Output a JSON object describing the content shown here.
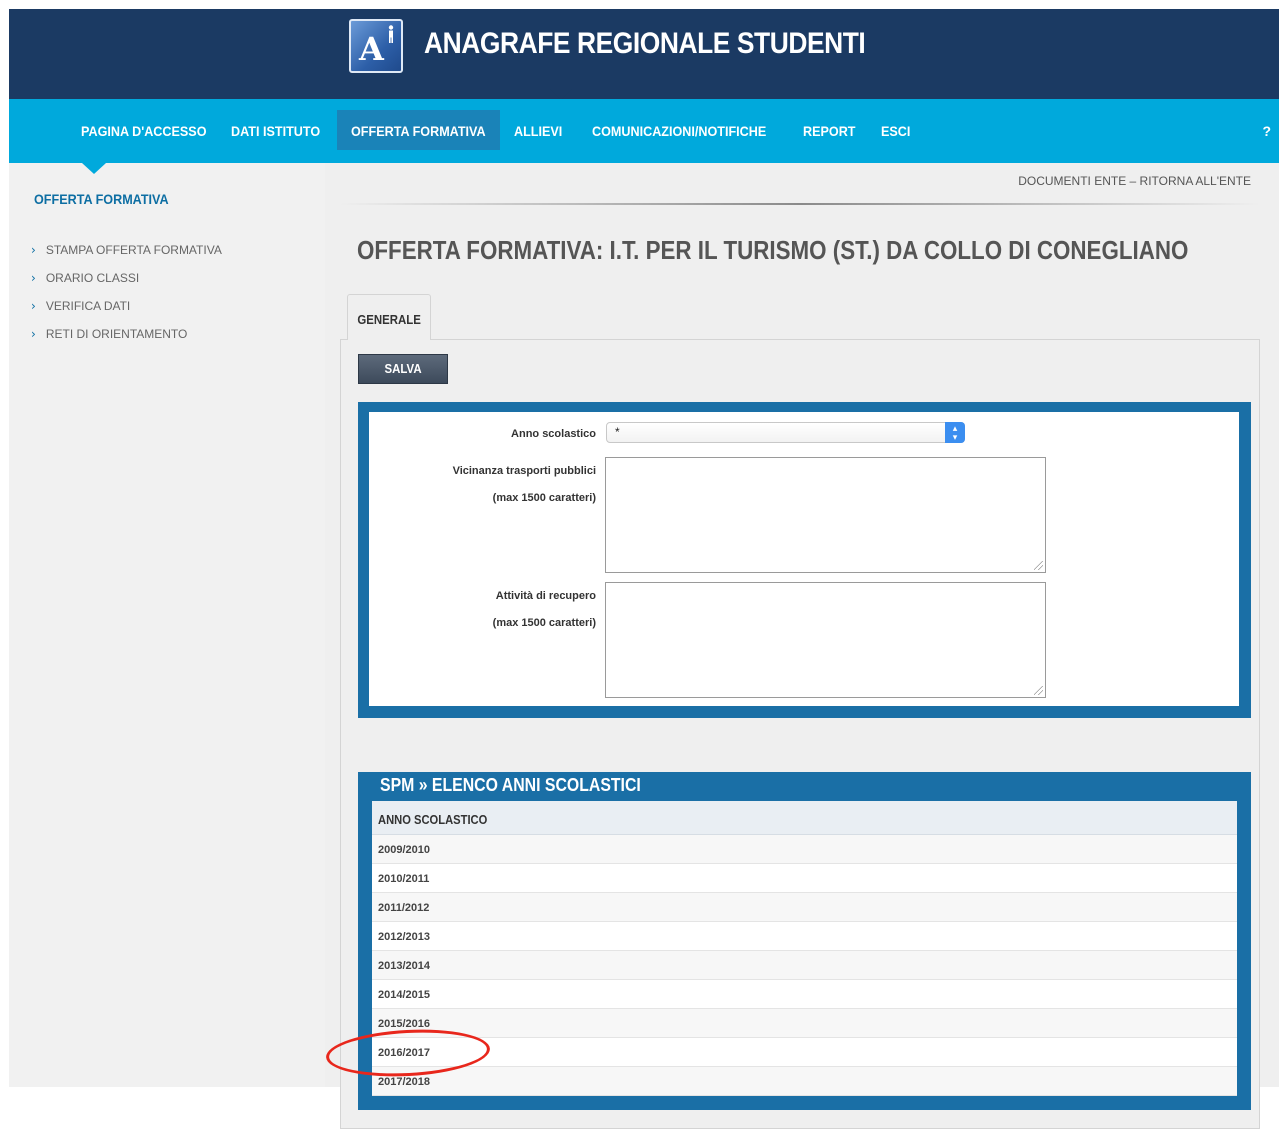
{
  "app": {
    "title": "ANAGRAFE REGIONALE STUDENTI",
    "logo_letter": "A"
  },
  "nav": {
    "items": [
      {
        "label": "PAGINA D'ACCESSO"
      },
      {
        "label": "DATI ISTITUTO"
      },
      {
        "label": "OFFERTA FORMATIVA",
        "active": true
      },
      {
        "label": "ALLIEVI"
      },
      {
        "label": "COMUNICAZIONI/NOTIFICHE"
      },
      {
        "label": "REPORT"
      },
      {
        "label": "ESCI"
      }
    ],
    "help": "?"
  },
  "sidebar": {
    "title": "OFFERTA FORMATIVA",
    "items": [
      {
        "label": "STAMPA OFFERTA FORMATIVA"
      },
      {
        "label": "ORARIO CLASSI"
      },
      {
        "label": "VERIFICA DATI"
      },
      {
        "label": "RETI DI ORIENTAMENTO"
      }
    ]
  },
  "top_links": "DOCUMENTI ENTE – RITORNA ALL'ENTE",
  "page_title": "OFFERTA FORMATIVA: I.T. PER IL TURISMO (ST.) DA COLLO DI CONEGLIANO",
  "tabs": [
    {
      "label": "GENERALE",
      "active": true
    }
  ],
  "save_button": "SALVA",
  "form": {
    "anno_label": "Anno scolastico",
    "anno_value": "*",
    "trasporti_label": "Vicinanza trasporti pubblici",
    "trasporti_hint": "(max 1500 caratteri)",
    "recupero_label": "Attività di recupero",
    "recupero_hint": "(max 1500 caratteri)"
  },
  "table": {
    "title": "SPM » ELENCO ANNI SCOLASTICI",
    "header": "ANNO SCOLASTICO",
    "rows": [
      "2009/2010",
      "2010/2011",
      "2011/2012",
      "2012/2013",
      "2013/2014",
      "2014/2015",
      "2015/2016",
      "2016/2017",
      "2017/2018"
    ],
    "highlighted_row": "2016/2017"
  },
  "colors": {
    "header_bg": "#1b3a63",
    "nav_bg": "#00a9dc",
    "nav_active": "#1a83b8",
    "frame": "#1a6fa6",
    "highlight": "#e8271c"
  }
}
